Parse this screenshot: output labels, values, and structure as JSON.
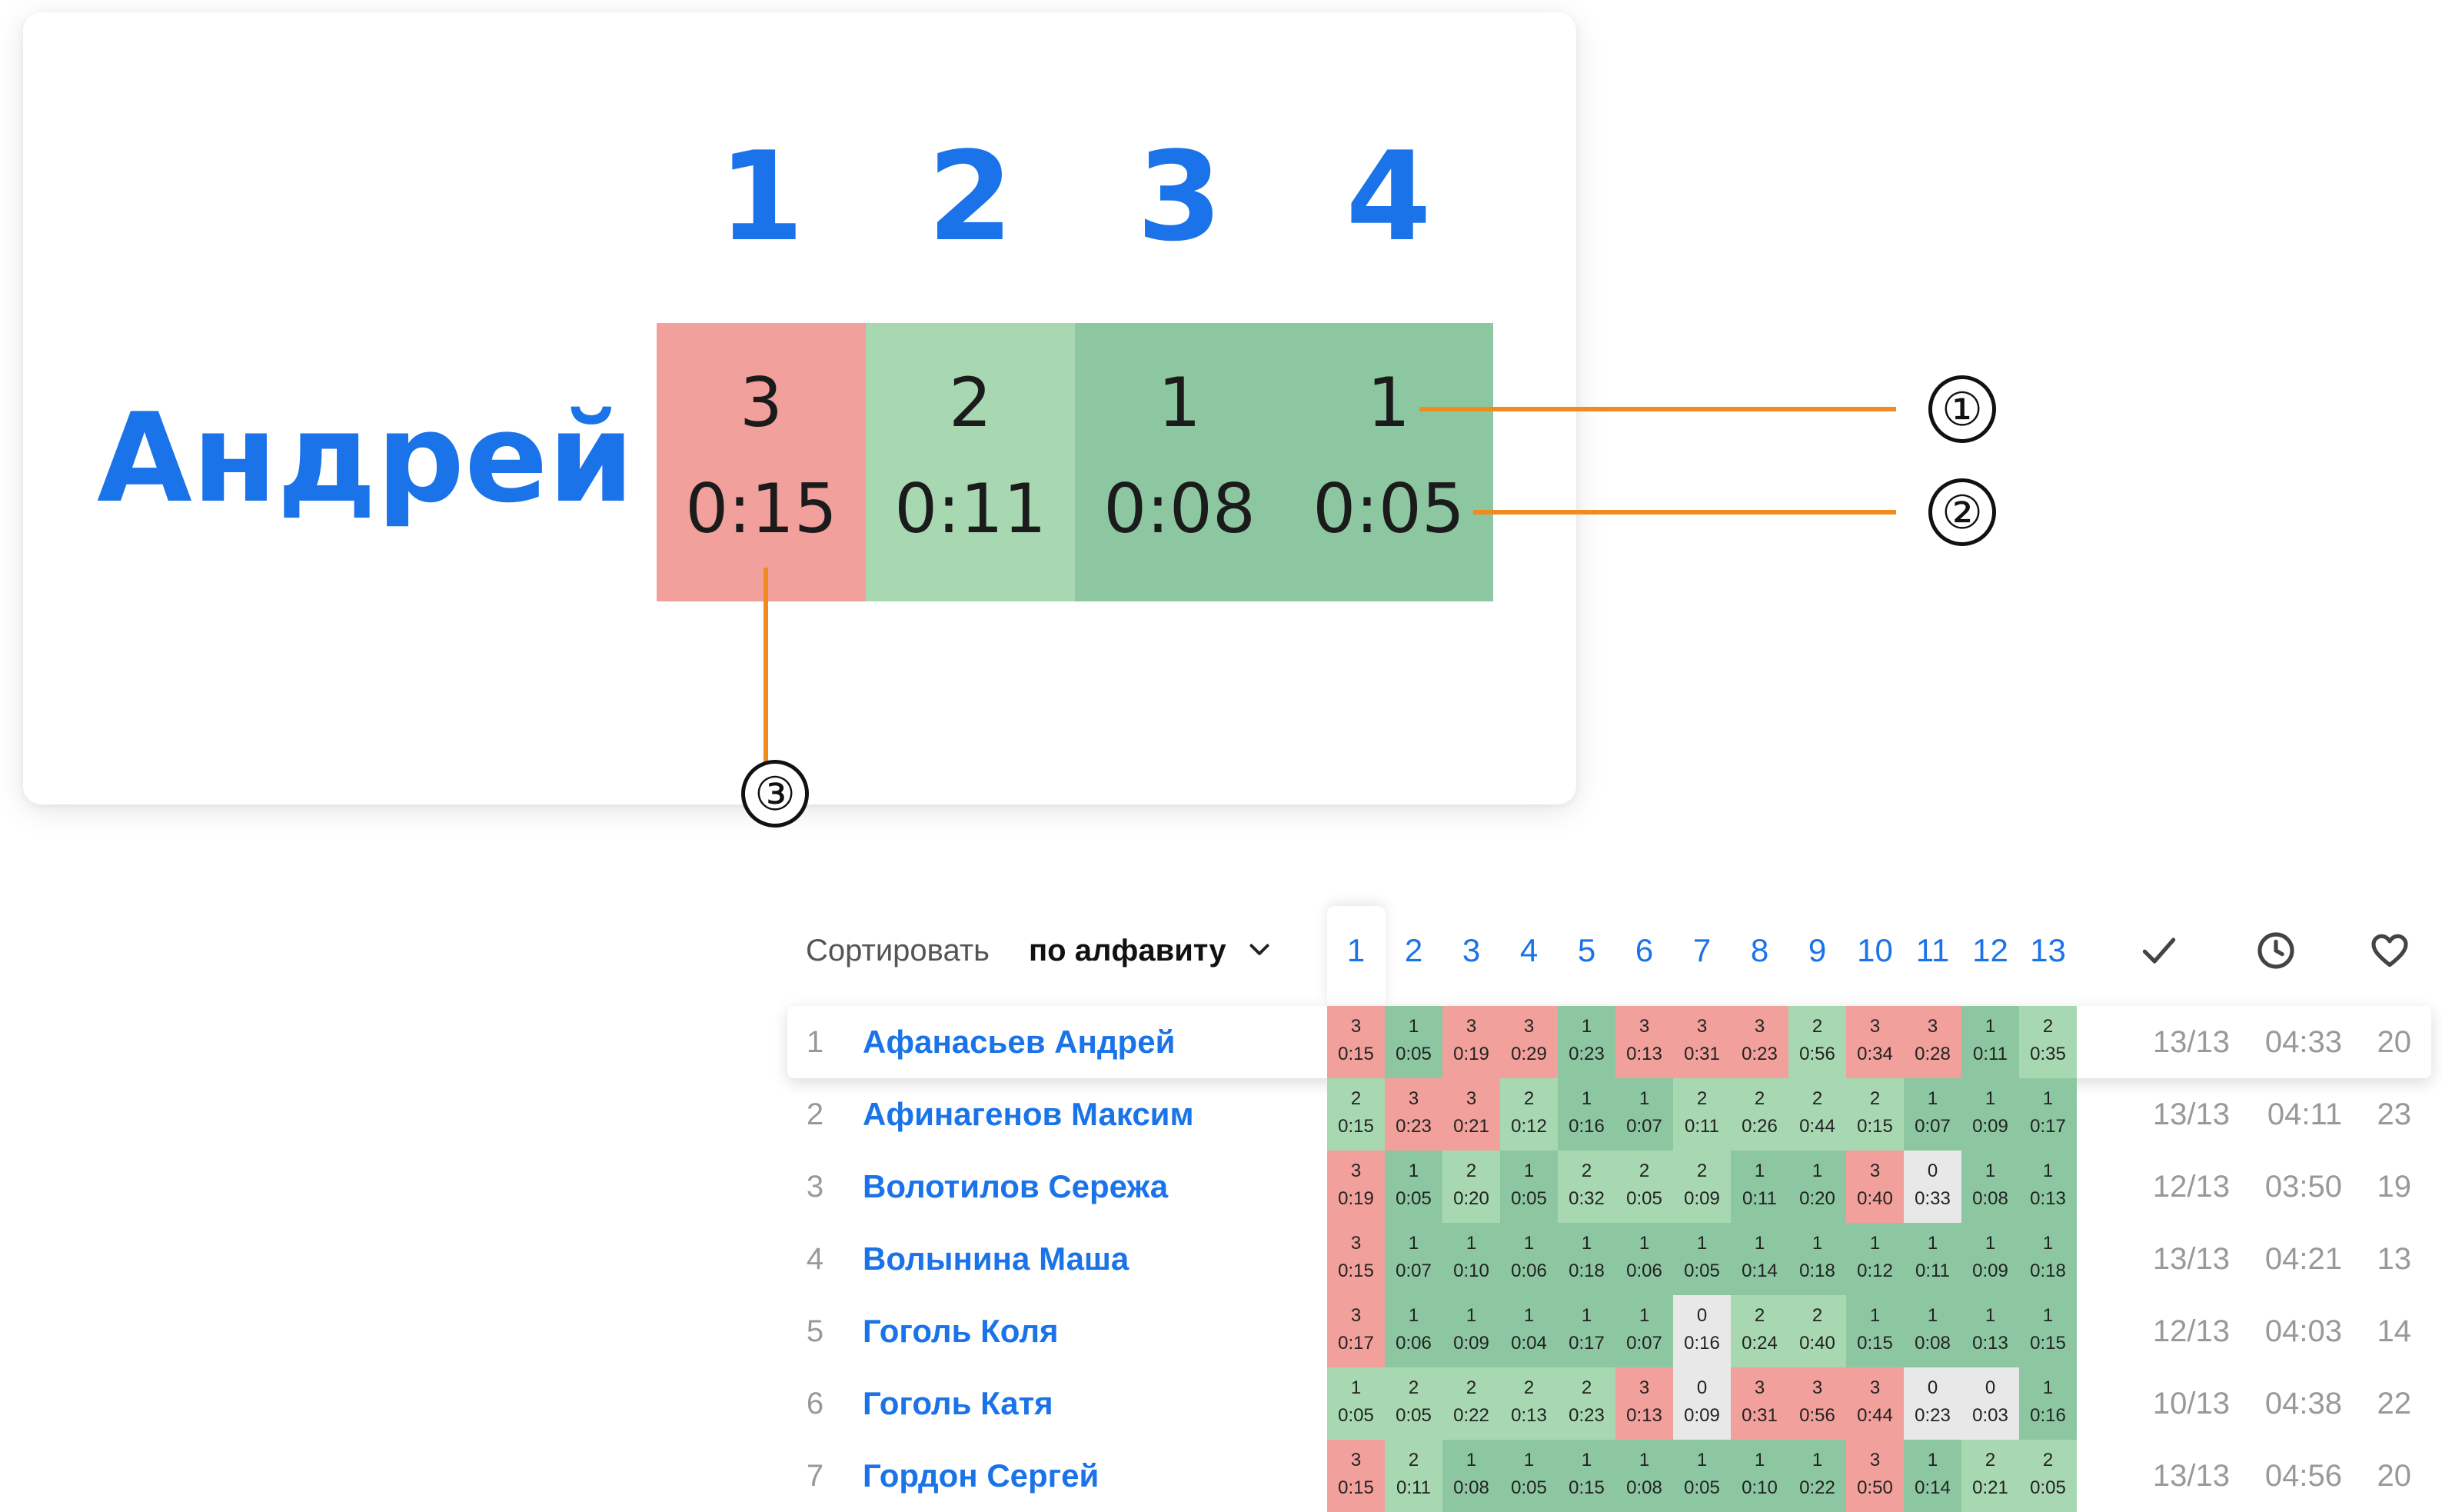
{
  "colors": {
    "accent": "#1a73e8",
    "fail": "#f1a09b",
    "slow": "#a8d8b2",
    "fast": "#8cc7a1",
    "unsolved": "#e8e8e8",
    "callout": "#f28b1e"
  },
  "zoom_card": {
    "name": "Андрей",
    "columns": [
      "1",
      "2",
      "3",
      "4"
    ],
    "cells": [
      {
        "tries": "3",
        "time": "0:15",
        "status": "fail"
      },
      {
        "tries": "2",
        "time": "0:11",
        "status": "slow"
      },
      {
        "tries": "1",
        "time": "0:08",
        "status": "fast"
      },
      {
        "tries": "1",
        "time": "0:05",
        "status": "fast"
      }
    ],
    "callouts": [
      "①",
      "②",
      "③"
    ]
  },
  "toolbar": {
    "sort_label": "Сортировать",
    "sort_value": "по алфавиту",
    "sort_icon": "chevron-down-icon"
  },
  "table": {
    "columns": [
      "1",
      "2",
      "3",
      "4",
      "5",
      "6",
      "7",
      "8",
      "9",
      "10",
      "11",
      "12",
      "13"
    ],
    "header_icons": [
      "check-icon",
      "clock-icon",
      "heart-icon"
    ],
    "rows": [
      {
        "num": "1",
        "name": "Афанасьев Андрей",
        "solved": "13/13",
        "total": "04:33",
        "likes": "20",
        "cells": [
          [
            "3",
            "0:15",
            "fail"
          ],
          [
            "1",
            "0:05",
            "fast"
          ],
          [
            "3",
            "0:19",
            "fail"
          ],
          [
            "3",
            "0:29",
            "fail"
          ],
          [
            "1",
            "0:23",
            "fast"
          ],
          [
            "3",
            "0:13",
            "fail"
          ],
          [
            "3",
            "0:31",
            "fail"
          ],
          [
            "3",
            "0:23",
            "fail"
          ],
          [
            "2",
            "0:56",
            "slow"
          ],
          [
            "3",
            "0:34",
            "fail"
          ],
          [
            "3",
            "0:28",
            "fail"
          ],
          [
            "1",
            "0:11",
            "fast"
          ],
          [
            "2",
            "0:35",
            "slow"
          ]
        ]
      },
      {
        "num": "2",
        "name": "Афинагенов Максим",
        "solved": "13/13",
        "total": "04:11",
        "likes": "23",
        "cells": [
          [
            "2",
            "0:15",
            "slow"
          ],
          [
            "3",
            "0:23",
            "fail"
          ],
          [
            "3",
            "0:21",
            "fail"
          ],
          [
            "2",
            "0:12",
            "slow"
          ],
          [
            "1",
            "0:16",
            "fast"
          ],
          [
            "1",
            "0:07",
            "fast"
          ],
          [
            "2",
            "0:11",
            "slow"
          ],
          [
            "2",
            "0:26",
            "slow"
          ],
          [
            "2",
            "0:44",
            "slow"
          ],
          [
            "2",
            "0:15",
            "slow"
          ],
          [
            "1",
            "0:07",
            "fast"
          ],
          [
            "1",
            "0:09",
            "fast"
          ],
          [
            "1",
            "0:17",
            "fast"
          ]
        ]
      },
      {
        "num": "3",
        "name": "Волотилов Сережа",
        "solved": "12/13",
        "total": "03:50",
        "likes": "19",
        "cells": [
          [
            "3",
            "0:19",
            "fail"
          ],
          [
            "1",
            "0:05",
            "fast"
          ],
          [
            "2",
            "0:20",
            "slow"
          ],
          [
            "1",
            "0:05",
            "fast"
          ],
          [
            "2",
            "0:32",
            "slow"
          ],
          [
            "2",
            "0:05",
            "slow"
          ],
          [
            "2",
            "0:09",
            "slow"
          ],
          [
            "1",
            "0:11",
            "fast"
          ],
          [
            "1",
            "0:20",
            "fast"
          ],
          [
            "3",
            "0:40",
            "fail"
          ],
          [
            "0",
            "0:33",
            "unsolved"
          ],
          [
            "1",
            "0:08",
            "fast"
          ],
          [
            "1",
            "0:13",
            "fast"
          ]
        ]
      },
      {
        "num": "4",
        "name": "Волынина Маша",
        "solved": "13/13",
        "total": "04:21",
        "likes": "13",
        "cells": [
          [
            "3",
            "0:15",
            "fail"
          ],
          [
            "1",
            "0:07",
            "fast"
          ],
          [
            "1",
            "0:10",
            "fast"
          ],
          [
            "1",
            "0:06",
            "fast"
          ],
          [
            "1",
            "0:18",
            "fast"
          ],
          [
            "1",
            "0:06",
            "fast"
          ],
          [
            "1",
            "0:05",
            "fast"
          ],
          [
            "1",
            "0:14",
            "fast"
          ],
          [
            "1",
            "0:18",
            "fast"
          ],
          [
            "1",
            "0:12",
            "fast"
          ],
          [
            "1",
            "0:11",
            "fast"
          ],
          [
            "1",
            "0:09",
            "fast"
          ],
          [
            "1",
            "0:18",
            "fast"
          ]
        ]
      },
      {
        "num": "5",
        "name": "Гоголь Коля",
        "solved": "12/13",
        "total": "04:03",
        "likes": "14",
        "cells": [
          [
            "3",
            "0:17",
            "fail"
          ],
          [
            "1",
            "0:06",
            "fast"
          ],
          [
            "1",
            "0:09",
            "fast"
          ],
          [
            "1",
            "0:04",
            "fast"
          ],
          [
            "1",
            "0:17",
            "fast"
          ],
          [
            "1",
            "0:07",
            "fast"
          ],
          [
            "0",
            "0:16",
            "unsolved"
          ],
          [
            "2",
            "0:24",
            "slow"
          ],
          [
            "2",
            "0:40",
            "slow"
          ],
          [
            "1",
            "0:15",
            "fast"
          ],
          [
            "1",
            "0:08",
            "fast"
          ],
          [
            "1",
            "0:13",
            "fast"
          ],
          [
            "1",
            "0:15",
            "fast"
          ]
        ]
      },
      {
        "num": "6",
        "name": "Гоголь Катя",
        "solved": "10/13",
        "total": "04:38",
        "likes": "22",
        "cells": [
          [
            "1",
            "0:05",
            "slow"
          ],
          [
            "2",
            "0:05",
            "slow"
          ],
          [
            "2",
            "0:22",
            "slow"
          ],
          [
            "2",
            "0:13",
            "slow"
          ],
          [
            "2",
            "0:23",
            "slow"
          ],
          [
            "3",
            "0:13",
            "fail"
          ],
          [
            "0",
            "0:09",
            "unsolved"
          ],
          [
            "3",
            "0:31",
            "fail"
          ],
          [
            "3",
            "0:56",
            "fail"
          ],
          [
            "3",
            "0:44",
            "fail"
          ],
          [
            "0",
            "0:23",
            "unsolved"
          ],
          [
            "0",
            "0:03",
            "unsolved"
          ],
          [
            "1",
            "0:16",
            "fast"
          ]
        ]
      },
      {
        "num": "7",
        "name": "Гордон Сергей",
        "solved": "13/13",
        "total": "04:56",
        "likes": "20",
        "cells": [
          [
            "3",
            "0:15",
            "fail"
          ],
          [
            "2",
            "0:11",
            "slow"
          ],
          [
            "1",
            "0:08",
            "fast"
          ],
          [
            "1",
            "0:05",
            "fast"
          ],
          [
            "1",
            "0:15",
            "fast"
          ],
          [
            "1",
            "0:08",
            "fast"
          ],
          [
            "1",
            "0:05",
            "fast"
          ],
          [
            "1",
            "0:10",
            "fast"
          ],
          [
            "1",
            "0:22",
            "fast"
          ],
          [
            "3",
            "0:50",
            "fail"
          ],
          [
            "1",
            "0:14",
            "fast"
          ],
          [
            "2",
            "0:21",
            "slow"
          ],
          [
            "2",
            "0:05",
            "slow"
          ]
        ]
      }
    ]
  }
}
